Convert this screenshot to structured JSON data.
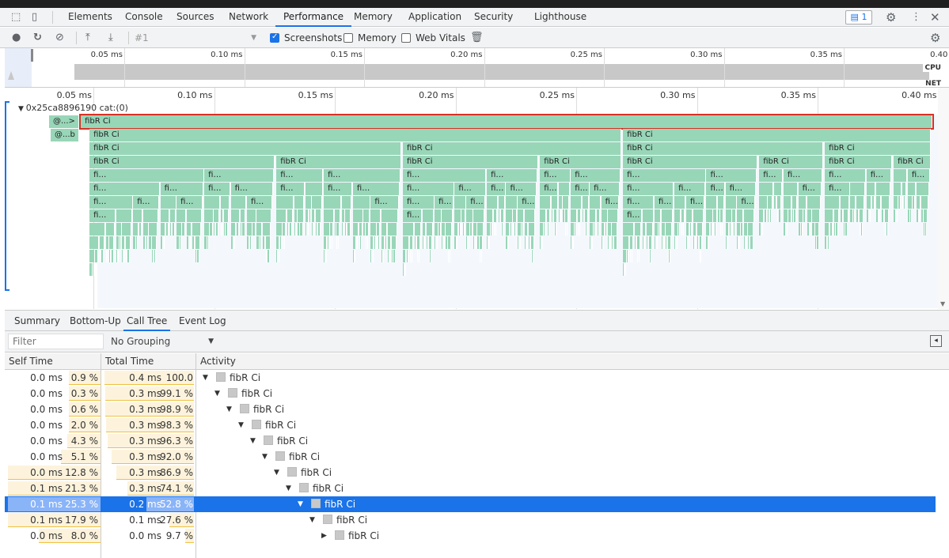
{
  "tabs": [
    "Elements",
    "Console",
    "Sources",
    "Network",
    "Performance",
    "Memory",
    "Application",
    "Security",
    "Lighthouse"
  ],
  "active_tab": "Performance",
  "issues_badge": "1",
  "toolbar": {
    "profile_select": "#1",
    "screenshots": "Screenshots",
    "screenshots_checked": true,
    "memory": "Memory",
    "memory_checked": false,
    "web_vitals": "Web Vitals",
    "web_vitals_checked": false
  },
  "overview": {
    "ticks": [
      "0.05 ms",
      "0.10 ms",
      "0.15 ms",
      "0.20 ms",
      "0.25 ms",
      "0.30 ms",
      "0.35 ms",
      "0.40 ms"
    ],
    "cpu_label": "CPU",
    "net_label": "NET"
  },
  "flame": {
    "ticks": [
      "0.05 ms",
      "0.10 ms",
      "0.15 ms",
      "0.20 ms",
      "0.25 ms",
      "0.30 ms",
      "0.35 ms",
      "0.40 ms"
    ],
    "thread_label": "0x25ca8896190 cat:(0)",
    "color": "#98d6b8",
    "selected_border": "#d93025",
    "callers": [
      "@...>",
      "@...b"
    ],
    "levels": [
      [
        {
          "label": "fibR Ci",
          "start": 0.0448,
          "end": 0.3975
        }
      ],
      [
        {
          "label": "fibR Ci",
          "start": 0.0484,
          "end": 0.2687
        },
        {
          "label": "fibR Ci",
          "start": 0.2694,
          "end": 0.3969
        }
      ],
      [
        {
          "label": "fibR Ci",
          "start": 0.0484,
          "end": 0.1775
        },
        {
          "label": "fibR Ci",
          "start": 0.1782,
          "end": 0.2687
        },
        {
          "label": "fibR Ci",
          "start": 0.2694,
          "end": 0.3523
        },
        {
          "label": "fibR Ci",
          "start": 0.353,
          "end": 0.3969
        }
      ],
      [
        {
          "label": "fibR Ci",
          "start": 0.0484,
          "end": 0.1251
        },
        {
          "label": "fibR Ci",
          "start": 0.1258,
          "end": 0.1775
        },
        {
          "label": "fibR Ci",
          "start": 0.1782,
          "end": 0.2343
        },
        {
          "label": "fibR Ci",
          "start": 0.235,
          "end": 0.2687
        },
        {
          "label": "fibR Ci",
          "start": 0.2694,
          "end": 0.3251
        },
        {
          "label": "fibR Ci",
          "start": 0.3258,
          "end": 0.3523
        },
        {
          "label": "fibR Ci",
          "start": 0.353,
          "end": 0.3808
        },
        {
          "label": "fibR Ci",
          "start": 0.3815,
          "end": 0.3969
        }
      ]
    ]
  },
  "bottom_tabs": [
    "Summary",
    "Bottom-Up",
    "Call Tree",
    "Event Log"
  ],
  "active_bottom_tab": "Call Tree",
  "filter_placeholder": "Filter",
  "grouping": "No Grouping",
  "columns": [
    "Self Time",
    "Total Time",
    "Activity"
  ],
  "rows": [
    {
      "self": "0.0 ms",
      "self_pct": "0.9 %",
      "total": "0.4 ms",
      "total_pct": "100.0 %",
      "activity": "fibR Ci",
      "expanded": true
    },
    {
      "self": "0.0 ms",
      "self_pct": "0.3 %",
      "total": "0.3 ms",
      "total_pct": "99.1 %",
      "activity": "fibR Ci",
      "expanded": true
    },
    {
      "self": "0.0 ms",
      "self_pct": "0.6 %",
      "total": "0.3 ms",
      "total_pct": "98.9 %",
      "activity": "fibR Ci",
      "expanded": true
    },
    {
      "self": "0.0 ms",
      "self_pct": "2.0 %",
      "total": "0.3 ms",
      "total_pct": "98.3 %",
      "activity": "fibR Ci",
      "expanded": true
    },
    {
      "self": "0.0 ms",
      "self_pct": "4.3 %",
      "total": "0.3 ms",
      "total_pct": "96.3 %",
      "activity": "fibR Ci",
      "expanded": true
    },
    {
      "self": "0.0 ms",
      "self_pct": "5.1 %",
      "total": "0.3 ms",
      "total_pct": "92.0 %",
      "activity": "fibR Ci",
      "expanded": true
    },
    {
      "self": "0.0 ms",
      "self_pct": "12.8 %",
      "total": "0.3 ms",
      "total_pct": "86.9 %",
      "activity": "fibR Ci",
      "expanded": true
    },
    {
      "self": "0.1 ms",
      "self_pct": "21.3 %",
      "total": "0.3 ms",
      "total_pct": "74.1 %",
      "activity": "fibR Ci",
      "expanded": true
    },
    {
      "self": "0.1 ms",
      "self_pct": "25.3 %",
      "total": "0.2 ms",
      "total_pct": "52.8 %",
      "activity": "fibR Ci",
      "expanded": true,
      "selected": true
    },
    {
      "self": "0.1 ms",
      "self_pct": "17.9 %",
      "total": "0.1 ms",
      "total_pct": "27.6 %",
      "activity": "fibR Ci",
      "expanded": true
    },
    {
      "self": "0.0 ms",
      "self_pct": "8.0 %",
      "total": "0.0 ms",
      "total_pct": "9.7 %",
      "activity": "fibR Ci",
      "expanded": false
    }
  ]
}
